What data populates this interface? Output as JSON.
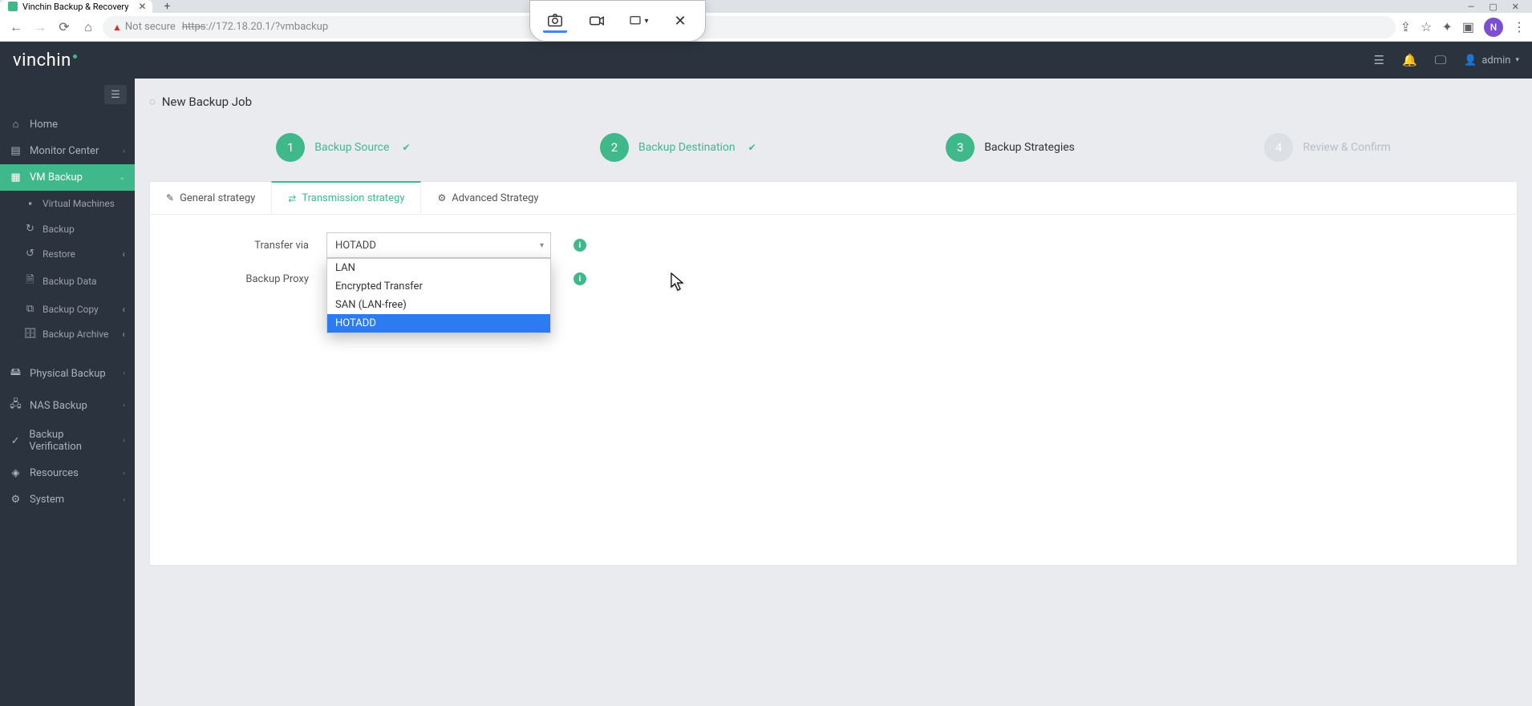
{
  "browser": {
    "tab_title": "Vinchin Backup & Recovery",
    "not_secure": "Not secure",
    "url_protocol": "https",
    "url_host": "://172.18.20.1/?vmbackup",
    "avatar_letter": "N"
  },
  "header": {
    "logo": "vinchin",
    "user": "admin"
  },
  "sidebar": {
    "home": "Home",
    "monitor": "Monitor Center",
    "vm_backup": "VM Backup",
    "vm_sub": {
      "virtual_machines": "Virtual Machines",
      "backup": "Backup",
      "restore": "Restore",
      "backup_data": "Backup Data",
      "backup_copy": "Backup Copy",
      "backup_archive": "Backup Archive"
    },
    "physical": "Physical Backup",
    "nas": "NAS Backup",
    "verify": "Backup Verification",
    "resources": "Resources",
    "system": "System"
  },
  "page": {
    "title": "New Backup Job",
    "steps": {
      "s1": "Backup Source",
      "s2": "Backup Destination",
      "s3": "Backup Strategies",
      "s4": "Review & Confirm"
    },
    "tabs": {
      "general": "General strategy",
      "transmission": "Transmission strategy",
      "advanced": "Advanced Strategy"
    },
    "form": {
      "transfer_via": "Transfer via",
      "backup_proxy": "Backup Proxy",
      "transfer_value": "HOTADD",
      "options": {
        "lan": "LAN",
        "encrypted": "Encrypted Transfer",
        "san": "SAN (LAN-free)",
        "hotadd": "HOTADD"
      }
    }
  }
}
